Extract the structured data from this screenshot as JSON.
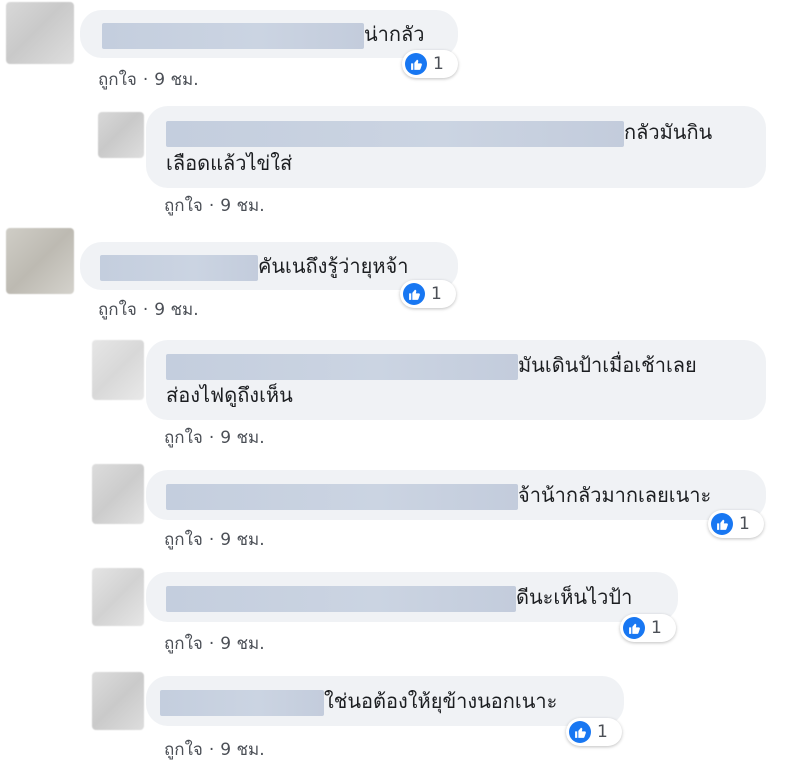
{
  "meta": {
    "like_label": "ถูกใจ",
    "separator": "·",
    "time_label": "9 ชม."
  },
  "comments": [
    {
      "text": "น่ากลัว",
      "reactions": "1"
    },
    {
      "text_line1": "กลัวมันกิน",
      "text_line2": "เลือดแล้วไข่ใส่"
    },
    {
      "text": "คันเนถึงรู้ว่ายุหจ้า",
      "reactions": "1"
    },
    {
      "text_line1": "มันเดินป้าเมื่อเช้าเลย",
      "text_line2": "ส่องไฟดูถึงเห็น"
    },
    {
      "text": "จ้าน้ากลัวมากเลยเนาะ",
      "reactions": "1"
    },
    {
      "text": "ดีนะเห็นไวป้า",
      "reactions": "1"
    },
    {
      "text": "ใช่นอต้องให้ยุข้างนอกเนาะ",
      "reactions": "1"
    }
  ],
  "colors": {
    "bubble": "#f0f2f5",
    "like_blue": "#1877f2",
    "meta_text": "#4b4f56"
  },
  "icons": {
    "reaction": "thumbs-up-icon"
  }
}
